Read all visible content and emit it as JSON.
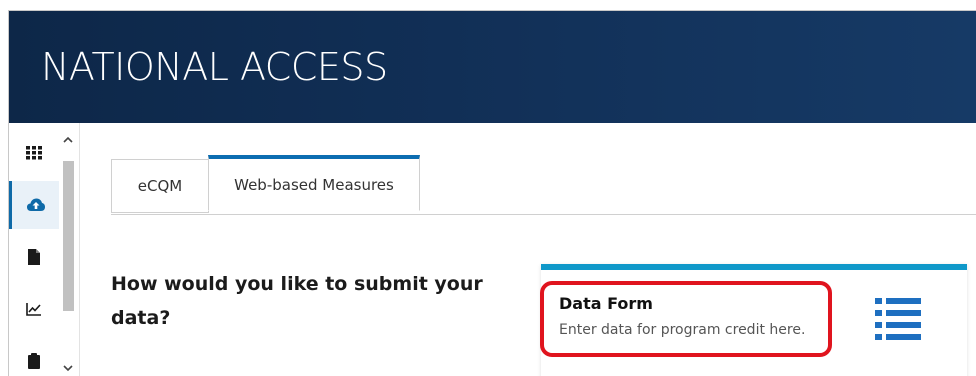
{
  "header": {
    "title": "NATIONAL ACCESS"
  },
  "rail": {
    "items": [
      {
        "icon": "grid-icon",
        "active": false
      },
      {
        "icon": "cloud-upload-icon",
        "active": true
      },
      {
        "icon": "file-icon",
        "active": false
      },
      {
        "icon": "line-chart-icon",
        "active": false
      },
      {
        "icon": "clipboard-icon",
        "active": false
      }
    ],
    "scroll_up_icon": "chevron-up-icon",
    "scroll_down_icon": "chevron-down-icon"
  },
  "tabs": [
    {
      "label": "eCQM",
      "active": false
    },
    {
      "label": "Web-based Measures",
      "active": true
    }
  ],
  "main": {
    "question": "How would you like to submit your data?"
  },
  "card": {
    "title": "Data Form",
    "description": "Enter data for program credit here.",
    "icon": "list-icon",
    "accent_color": "#0f98c9"
  },
  "colors": {
    "header_bg": "#112f56",
    "tab_accent": "#0c6db1",
    "highlight": "#e0141e",
    "icon_blue": "#1e6fc0"
  }
}
